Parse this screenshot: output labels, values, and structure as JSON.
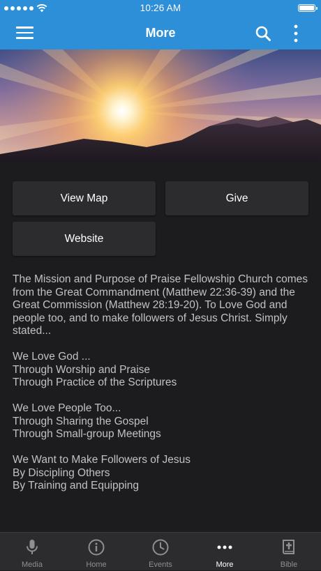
{
  "status_bar": {
    "time": "10:26 AM"
  },
  "nav": {
    "title": "More"
  },
  "buttons": {
    "view_map": "View Map",
    "give": "Give",
    "website": "Website"
  },
  "content": {
    "paragraphs": [
      "The Mission and Purpose of Praise Fellowship Church comes from the Great Commandment (Matthew 22:36-39) and the Great Commission (Matthew 28:19-20). To Love God and people too, and to make followers of Jesus Christ. Simply stated...",
      "We Love God ...",
      "Through Worship and Praise",
      "Through Practice of the Scriptures",
      "We Love People Too...",
      "Through Sharing the Gospel",
      "Through Small-group Meetings",
      "We Want to Make Followers of Jesus",
      "By Discipling Others",
      "By Training and Equipping"
    ]
  },
  "tabbar": {
    "tabs": [
      {
        "label": "Media",
        "icon": "microphone-icon"
      },
      {
        "label": "Home",
        "icon": "info-icon"
      },
      {
        "label": "Events",
        "icon": "clock-icon"
      },
      {
        "label": "More",
        "icon": "more-dots-icon"
      },
      {
        "label": "Bible",
        "icon": "bible-icon"
      }
    ],
    "active_tab": "More"
  },
  "colors": {
    "accent": "#2d8fd8",
    "background": "#1c1c1e",
    "button": "#2c2c2e",
    "tabbar": "#2c2c2e"
  }
}
